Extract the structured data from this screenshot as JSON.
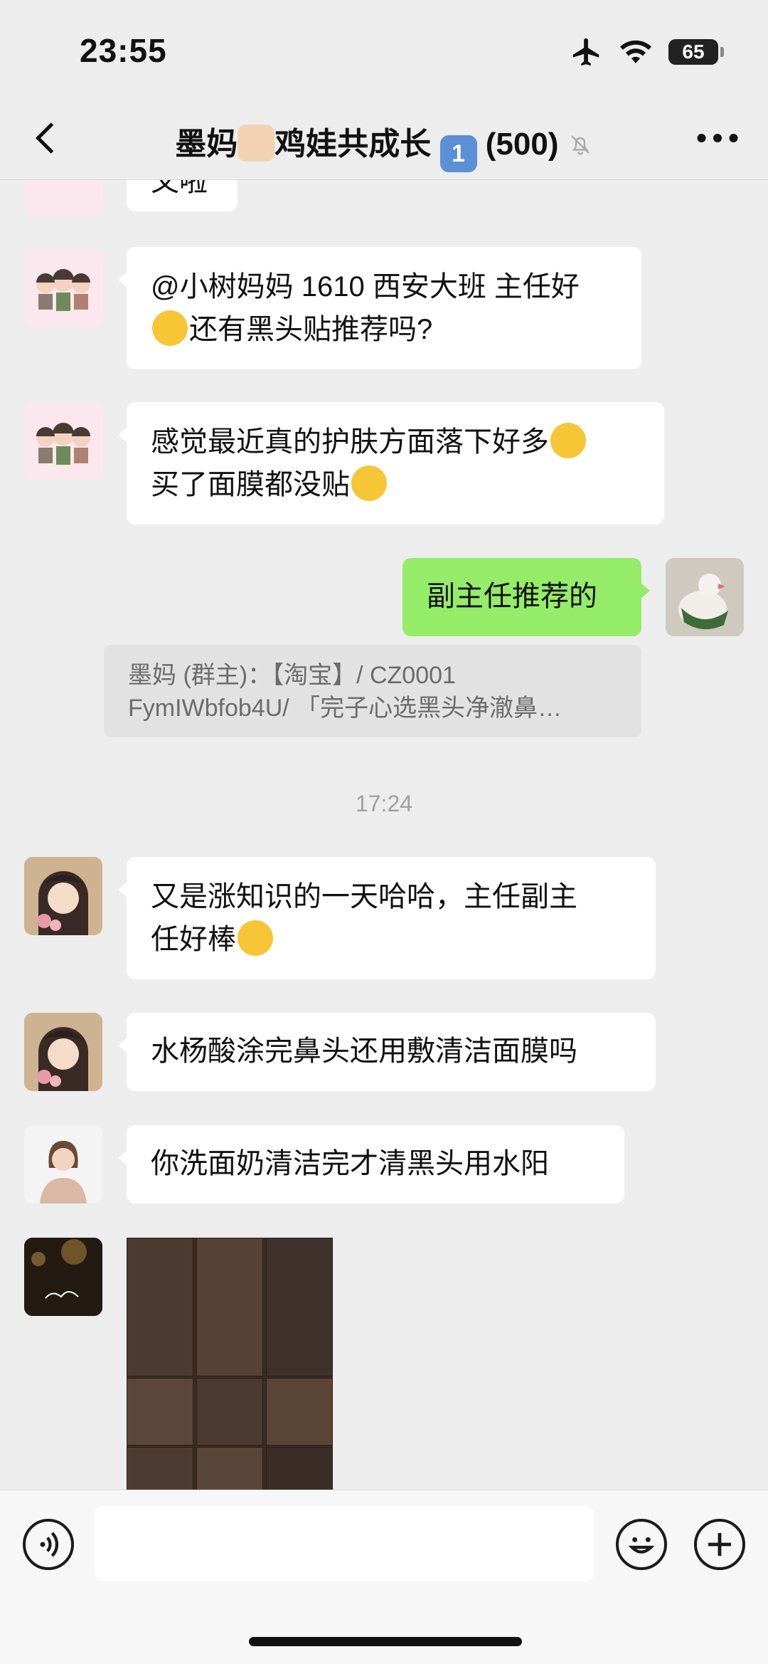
{
  "status_bar": {
    "time": "23:55",
    "battery": "65"
  },
  "header": {
    "title_part1": "墨妈",
    "title_part2": "鸡娃共成长",
    "title_badge": "1",
    "title_count": "(500)"
  },
  "messages": {
    "m0": "又啦",
    "m1_line1": "@小树妈妈 1610 西安大班 主任好",
    "m1_line2": "还有黑头贴推荐吗?",
    "m2_line1": "感觉最近真的护肤方面落下好多",
    "m2_line2": "买了面膜都没贴",
    "m3": "副主任推荐的",
    "quote_line1": "墨妈 (群主)：【淘宝】/ CZ0001",
    "quote_line2": "FymIWbfob4U/ 「完子心选黑头净澈鼻…",
    "time_sep": "17:24",
    "m4_line1": "又是涨知识的一天哈哈，主任副主",
    "m4_line2": "任好棒",
    "m5": "水杨酸涂完鼻头还用敷清洁面膜吗",
    "m6": "你洗面奶清洁完才清黑头用水阳"
  },
  "icons": {
    "back": "chevron-left-icon",
    "mute": "bell-off-icon",
    "more": "more-dots-icon",
    "voice": "voice-icon",
    "emoji": "emoji-icon",
    "plus": "plus-icon"
  },
  "colors": {
    "bubble_self": "#95ec69",
    "background": "#ededed"
  }
}
